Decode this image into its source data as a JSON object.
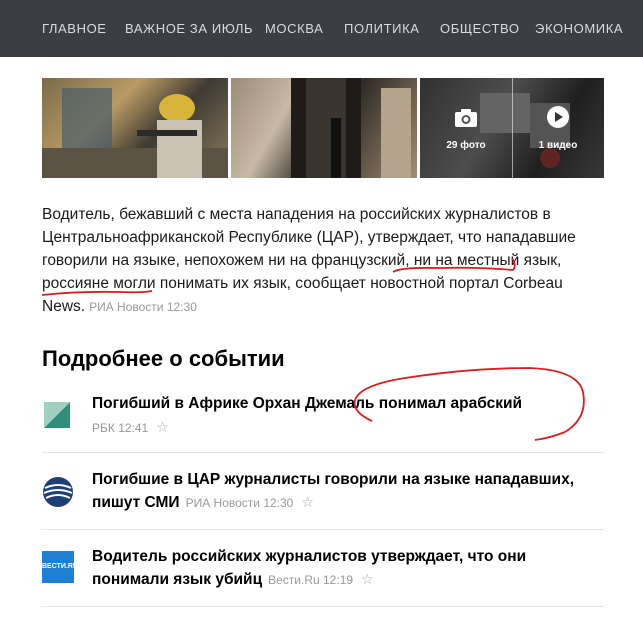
{
  "nav": {
    "items": [
      "ГЛАВНОЕ",
      "ВАЖНОЕ ЗА ИЮЛЬ",
      "МОСКВА",
      "ПОЛИТИКА",
      "ОБЩЕСТВО",
      "ЭКОНОМИКА"
    ]
  },
  "media": {
    "photos_label": "29 фото",
    "video_label": "1 видео"
  },
  "article": {
    "lead_text_1": "Водитель, бежавший с места нападения на российских журналистов в Центральноафриканской Республике (ЦАР), утверждает, что нападавшие говорили на языке, непохожем ни на ",
    "lead_french": "французский",
    "lead_text_2": ", ни на ",
    "lead_local": "местный язык",
    "lead_text_3": ", россияне могли понимать их язык, сообщает новостной портал Corbeau News.",
    "source": "РИА Новости 12:30"
  },
  "section": {
    "title": "Подробнее о событии"
  },
  "related": [
    {
      "title": "Погибший в Африке Орхан Джемаль понимал арабский",
      "source": "РБК 12:41"
    },
    {
      "title": "Погибшие в ЦАР журналисты говорили на языке нападавших, пишут СМИ",
      "source": "РИА Новости 12:30"
    },
    {
      "title": "Водитель российских журналистов утверждает, что они понимали язык убийц",
      "source": "Вести.Ru 12:19"
    }
  ],
  "icons": {
    "vesti_logo_text": "ВЕСТИ.RU"
  },
  "colors": {
    "nav_bg": "#3b3f45",
    "annotation_red": "#d81e1e",
    "rbc_green": "#2f8f7a",
    "ria_blue": "#1e3f73",
    "vesti_blue": "#1f7fd1"
  }
}
